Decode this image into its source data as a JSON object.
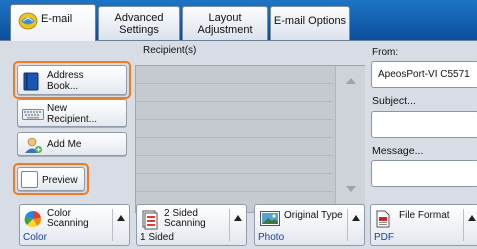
{
  "tabs": [
    {
      "label": "E-mail"
    },
    {
      "label": "Advanced\nSettings"
    },
    {
      "label": "Layout\nAdjustment"
    },
    {
      "label": "E-mail Options"
    }
  ],
  "recipients_header": "Recipient(s)",
  "buttons": {
    "address_book": "Address\nBook...",
    "new_recipient": "New\nRecipient...",
    "add_me": "Add Me",
    "preview": "Preview"
  },
  "from": {
    "label": "From:",
    "value": "ApeosPort-VI C5571"
  },
  "subject": {
    "label": "Subject...",
    "value": ""
  },
  "message": {
    "label": "Message...",
    "value": ""
  },
  "features": [
    {
      "title": "Color\nScanning",
      "value": "Color",
      "icon": "color-wheel-icon"
    },
    {
      "title": "2 Sided\nScanning",
      "value": "1 Sided",
      "icon": "two-sided-icon"
    },
    {
      "title": "Original Type",
      "value": "Photo",
      "icon": "photo-icon"
    },
    {
      "title": "File Format",
      "value": "PDF",
      "icon": "pdf-icon"
    }
  ],
  "colors": {
    "tabbar": "#1e74c4",
    "highlight": "#ee7a25",
    "value_text": "#1a3f9c"
  }
}
